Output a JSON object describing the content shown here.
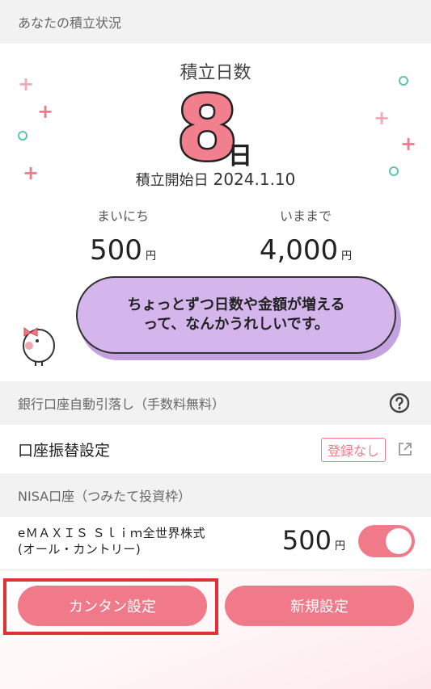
{
  "section_savings": {
    "title": "あなたの積立状況"
  },
  "savings": {
    "days_label": "積立日数",
    "days_value": "8",
    "days_unit": "日",
    "start_label": "積立開始日",
    "start_date": "2024.1.10",
    "daily_label": "まいにち",
    "daily_amount": "500",
    "total_label": "いままで",
    "total_amount": "4,000",
    "yen": "円",
    "message_line1": "ちょっとずつ日数や金額が増える",
    "message_line2": "って、なんかうれしいです。"
  },
  "section_bank": {
    "title": "銀行口座自動引落し（手数料無料）",
    "help_icon": "question-circle-icon"
  },
  "bank_row": {
    "label": "口座振替設定",
    "status": "登録なし",
    "icon": "external-link-icon"
  },
  "section_nisa": {
    "title": "NISA口座（つみたて投資枠）"
  },
  "fund": {
    "name_line1": "eＭＡＸＩＳ Ｓｌｉｍ全世界株式",
    "name_line2": "(オール・カントリー)",
    "amount": "500",
    "yen": "円",
    "toggle_on": true
  },
  "actions": {
    "easy_setup": "カンタン設定",
    "new_setup": "新規設定"
  },
  "colors": {
    "accent": "#f07a8a",
    "bubble": "#d4b6ec",
    "highlight": "#e03232",
    "ring": "#5bc6a8"
  }
}
